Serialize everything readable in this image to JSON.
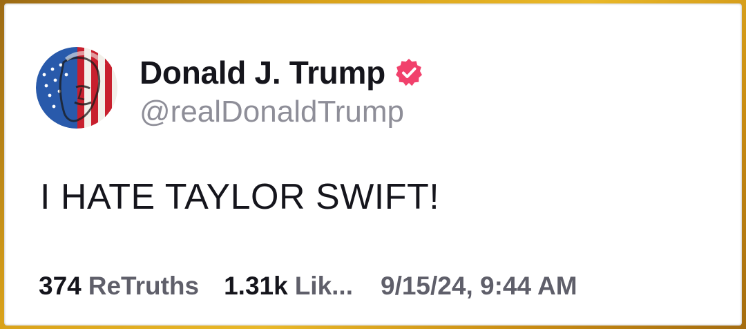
{
  "post": {
    "author": {
      "display_name": "Donald J. Trump",
      "handle": "@realDonaldTrump",
      "verified": true,
      "verified_icon": "verified-badge-icon",
      "avatar_icon": "profile-avatar"
    },
    "text": "I HATE TAYLOR SWIFT!",
    "stats": {
      "retruths_count": "374",
      "retruths_label": "ReTruths",
      "likes_count": "1.31k",
      "likes_label": "Lik...",
      "timestamp": "9/15/24, 9:44 AM"
    }
  },
  "colors": {
    "frame_gold": "#d9a21a",
    "card_background": "#ffffff",
    "text_primary": "#15151c",
    "text_secondary": "#8e8e98",
    "stat_label": "#5f5f6a",
    "verified_badge": "#f1416c"
  }
}
